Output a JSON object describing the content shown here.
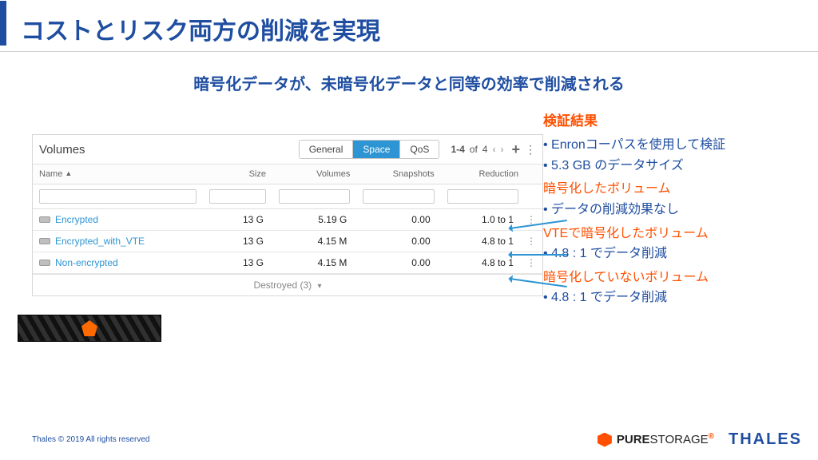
{
  "slide": {
    "title": "コストとリスク両方の削減を実現",
    "subtitle": "暗号化データが、未暗号化データと同等の効率で削減される"
  },
  "volumes_panel": {
    "title": "Volumes",
    "tabs": {
      "general": "General",
      "space": "Space",
      "qos": "QoS"
    },
    "pager": {
      "range": "1-4",
      "of_word": "of",
      "total": "4"
    },
    "columns": {
      "name": "Name",
      "size": "Size",
      "volumes": "Volumes",
      "snapshots": "Snapshots",
      "reduction": "Reduction"
    },
    "rows": [
      {
        "name": "Encrypted",
        "size": "13 G",
        "volumes": "5.19 G",
        "snapshots": "0.00",
        "reduction": "1.0 to 1"
      },
      {
        "name": "Encrypted_with_VTE",
        "size": "13 G",
        "volumes": "4.15 M",
        "snapshots": "0.00",
        "reduction": "4.8 to 1"
      },
      {
        "name": "Non-encrypted",
        "size": "13 G",
        "volumes": "4.15 M",
        "snapshots": "0.00",
        "reduction": "4.8 to 1"
      }
    ],
    "destroyed": "Destroyed (3)"
  },
  "notes": {
    "heading": "検証結果",
    "bullets_top": [
      "Enronコーパスを使用して検証",
      "5.3 GB のデータサイズ"
    ],
    "group1_title": "暗号化したボリューム",
    "group1_bullets": [
      "データの削減効果なし"
    ],
    "group2_title": "VTEで暗号化したボリューム",
    "group2_bullets": [
      "4.8 : 1 でデータ削減"
    ],
    "group3_title": "暗号化していないボリューム",
    "group3_bullets": [
      "4.8 : 1 でデータ削減"
    ]
  },
  "footer": {
    "copyright": "Thales © 2019 All rights reserved",
    "brand_pure_strong": "PURE",
    "brand_pure_light": "STORAGE",
    "brand_thales": "THALES"
  }
}
